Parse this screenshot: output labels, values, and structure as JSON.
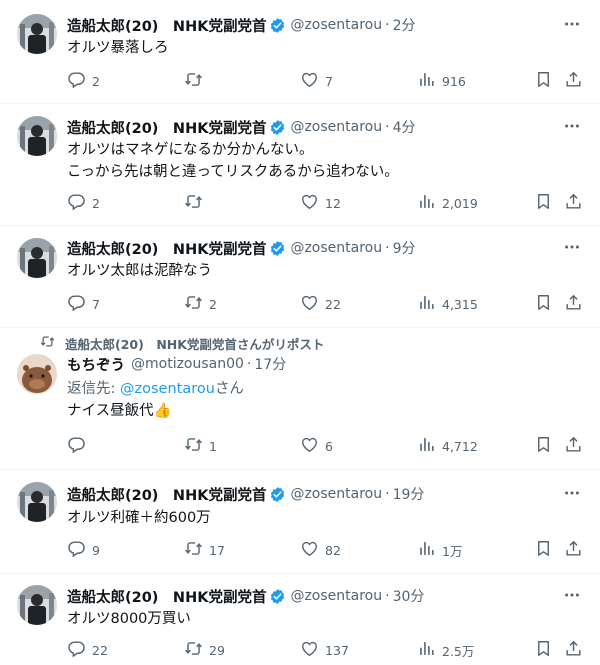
{
  "colors": {
    "accent": "#1d9bf0",
    "muted": "#536471",
    "text": "#0f1419",
    "divider": "#eff3f4"
  },
  "tweets": [
    {
      "name": "造船太郎(20)　NHK党副党首",
      "handle": "@zosentarou",
      "time": "2分",
      "lines": [
        "オルツ暴落しろ"
      ],
      "replies": "2",
      "reposts": "",
      "likes": "7",
      "views": "916"
    },
    {
      "name": "造船太郎(20)　NHK党副党首",
      "handle": "@zosentarou",
      "time": "4分",
      "lines": [
        "オルツはマネゲになるか分かんない。",
        "こっから先は朝と違ってリスクあるから追わない。"
      ],
      "replies": "2",
      "reposts": "",
      "likes": "12",
      "views": "2,019"
    },
    {
      "name": "造船太郎(20)　NHK党副党首",
      "handle": "@zosentarou",
      "time": "9分",
      "lines": [
        "オルツ太郎は泥酔なう"
      ],
      "replies": "7",
      "reposts": "2",
      "likes": "22",
      "views": "4,315"
    },
    {
      "repost_note": "造船太郎(20)　NHK党副党首さんがリポスト",
      "name": "もちぞう",
      "handle": "@motizousan00",
      "time": "17分",
      "reply_prefix": "返信先: ",
      "reply_to": "@zosentarou",
      "reply_suffix": "さん",
      "lines": [
        "ナイス昼飯代👍"
      ],
      "replies": "",
      "reposts": "1",
      "likes": "6",
      "views": "4,712"
    },
    {
      "name": "造船太郎(20)　NHK党副党首",
      "handle": "@zosentarou",
      "time": "19分",
      "lines": [
        "オルツ利確＋約600万"
      ],
      "replies": "9",
      "reposts": "17",
      "likes": "82",
      "views": "1万"
    },
    {
      "name": "造船太郎(20)　NHK党副党首",
      "handle": "@zosentarou",
      "time": "30分",
      "lines": [
        "オルツ8000万買い"
      ],
      "replies": "22",
      "reposts": "29",
      "likes": "137",
      "views": "2.5万"
    }
  ]
}
